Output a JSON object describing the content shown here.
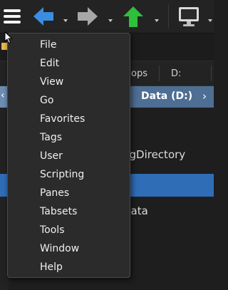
{
  "toolbar": {
    "icons": [
      "hamburger-menu-icon",
      "back-arrow-icon",
      "forward-arrow-icon",
      "up-arrow-icon",
      "monitor-icon"
    ],
    "colors": {
      "back": "#3b8de0",
      "forward": "#a7a7a7",
      "up": "#2fbf3c"
    }
  },
  "background": {
    "tabs": [
      "ops",
      "D:"
    ],
    "path_label": "Data (D:)",
    "rows": [
      "ngDirectory",
      "",
      "Data"
    ]
  },
  "menu": {
    "items": [
      "File",
      "Edit",
      "View",
      "Go",
      "Favorites",
      "Tags",
      "User",
      "Scripting",
      "Panes",
      "Tabsets",
      "Tools",
      "Window",
      "Help"
    ]
  },
  "colors": {
    "selection": "#2f6db7",
    "pathbar": "#4e6e94",
    "menu_bg": "#2b2b2b"
  }
}
